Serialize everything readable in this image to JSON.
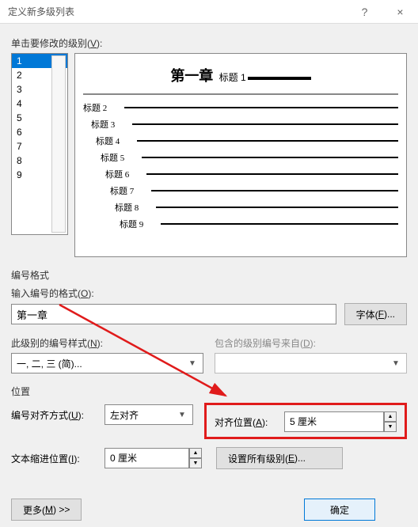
{
  "window": {
    "title": "定义新多级列表",
    "help": "?",
    "close": "×"
  },
  "levels": {
    "label_prefix": "单击要修改的级别(",
    "label_key": "V",
    "label_suffix": "):",
    "items": [
      "1",
      "2",
      "3",
      "4",
      "5",
      "6",
      "7",
      "8",
      "9"
    ]
  },
  "preview": {
    "title_main": "第一章",
    "title_sub": "标题 1",
    "rows": [
      "标题 2",
      "标题 3",
      "标题 4",
      "标题 5",
      "标题 6",
      "标题 7",
      "标题 8",
      "标题 9"
    ]
  },
  "number_format": {
    "section": "编号格式",
    "input_label_pre": "输入编号的格式(",
    "input_key": "O",
    "input_label_suf": "):",
    "value": "第一章",
    "font_btn_pre": "字体(",
    "font_key": "F",
    "font_btn_suf": ")..."
  },
  "style": {
    "label_pre": "此级别的编号样式(",
    "key": "N",
    "label_suf": "):",
    "value": "一, 二, 三 (简)...",
    "include_label_pre": "包含的级别编号来自(",
    "include_key": "D",
    "include_label_suf": "):"
  },
  "position": {
    "section": "位置",
    "align_label_pre": "编号对齐方式(",
    "align_key": "U",
    "align_label_suf": "):",
    "align_value": "左对齐",
    "alignpos_label_pre": "对齐位置(",
    "alignpos_key": "A",
    "alignpos_label_suf": "):",
    "alignpos_value": "5 厘米",
    "indent_label_pre": "文本缩进位置(",
    "indent_key": "I",
    "indent_label_suf": "):",
    "indent_value": "0 厘米",
    "setall_pre": "设置所有级别(",
    "setall_key": "E",
    "setall_suf": ")..."
  },
  "buttons": {
    "more_pre": "更多(",
    "more_key": "M",
    "more_suf": ") >>",
    "ok": "确定"
  }
}
